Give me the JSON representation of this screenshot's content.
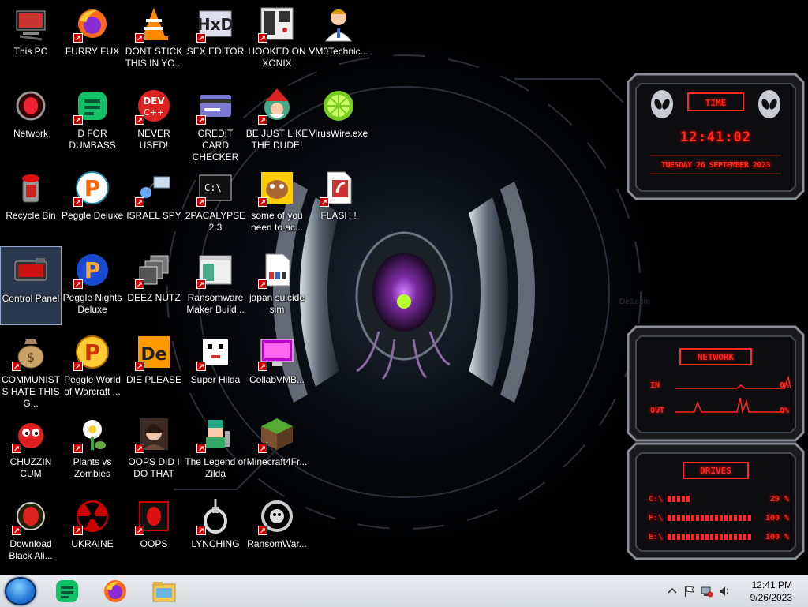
{
  "desktop_icons": [
    {
      "label": "This PC",
      "icon": "computer-icon",
      "shortcut": false
    },
    {
      "label": "Network",
      "icon": "alienware-network-icon",
      "shortcut": false
    },
    {
      "label": "Recycle Bin",
      "icon": "recycle-bin-icon",
      "shortcut": false
    },
    {
      "label": "Control Panel",
      "icon": "control-panel-icon",
      "shortcut": false
    },
    {
      "label": "COMMUNISTS HATE THIS G...",
      "icon": "money-bag-icon",
      "shortcut": true
    },
    {
      "label": "CHUZZIN CUM",
      "icon": "chuzzle-icon",
      "shortcut": true
    },
    {
      "label": "Download Black Ali...",
      "icon": "alienware-icon",
      "shortcut": true
    },
    {
      "label": "FURRY FUX",
      "icon": "firefox-icon",
      "shortcut": true
    },
    {
      "label": "D FOR DUMBASS",
      "icon": "green-doc-icon",
      "shortcut": true
    },
    {
      "label": "Peggle Deluxe",
      "icon": "peggle-icon",
      "shortcut": true
    },
    {
      "label": "Peggle Nights Deluxe",
      "icon": "peggle-nights-icon",
      "shortcut": true
    },
    {
      "label": "Peggle World of Warcraft ...",
      "icon": "peggle-wow-icon",
      "shortcut": true
    },
    {
      "label": "Plants vs Zombies",
      "icon": "flower-icon",
      "shortcut": true
    },
    {
      "label": "UKRAINE",
      "icon": "radiation-icon",
      "shortcut": true
    },
    {
      "label": "DONT STICK THIS IN YO...",
      "icon": "vlc-cone-icon",
      "shortcut": true
    },
    {
      "label": "NEVER USED!",
      "icon": "devcpp-icon",
      "shortcut": true
    },
    {
      "label": "ISRAEL SPY",
      "icon": "network-spy-icon",
      "shortcut": true
    },
    {
      "label": "DEEZ NUTZ",
      "icon": "stacked-windows-icon",
      "shortcut": true
    },
    {
      "label": "DIE PLEASE",
      "icon": "de-icon",
      "shortcut": true
    },
    {
      "label": "OOPS DID I DO THAT",
      "icon": "portrait-icon",
      "shortcut": true
    },
    {
      "label": "OOPS",
      "icon": "red-alien-icon",
      "shortcut": true
    },
    {
      "label": "SEX EDITOR",
      "icon": "hxd-icon",
      "shortcut": true
    },
    {
      "label": "CREDIT CARD CHECKER",
      "icon": "credit-card-icon",
      "shortcut": true
    },
    {
      "label": "2PACALYPSE 2.3",
      "icon": "terminal-icon",
      "shortcut": true
    },
    {
      "label": "Ransomware Maker Build...",
      "icon": "window-app-icon",
      "shortcut": true
    },
    {
      "label": "Super Hilda",
      "icon": "pixel-dog-icon",
      "shortcut": true
    },
    {
      "label": "The Legend of Zilda",
      "icon": "pixel-hero-icon",
      "shortcut": true
    },
    {
      "label": "LYNCHING",
      "icon": "noose-icon",
      "shortcut": true
    },
    {
      "label": "HOOKED ON XONIX",
      "icon": "xonix-icon",
      "shortcut": true
    },
    {
      "label": "BE JUST LIKE THE DUDE!",
      "icon": "santa-icon",
      "shortcut": true
    },
    {
      "label": "some of you need to ac...",
      "icon": "cartoon-dog-icon",
      "shortcut": true
    },
    {
      "label": "japan suicide sim",
      "icon": "document-icon",
      "shortcut": true
    },
    {
      "label": "CollabVMB...",
      "icon": "screen-icon",
      "shortcut": true
    },
    {
      "label": "Minecraft4Fr...",
      "icon": "grass-block-icon",
      "shortcut": true
    },
    {
      "label": "RansomWar...",
      "icon": "skull-ring-icon",
      "shortcut": true
    },
    {
      "label": "VM0Technic...",
      "icon": "doctor-icon",
      "shortcut": false
    },
    {
      "label": "VirusWire.exe",
      "icon": "lime-icon",
      "shortcut": false
    },
    {
      "label": "FLASH !",
      "icon": "flash-icon",
      "shortcut": true
    }
  ],
  "gadget_time": {
    "title": "TIME",
    "time": "12:41:02",
    "date": "TUESDAY 26 SEPTEMBER 2023"
  },
  "gadget_network": {
    "title": "NETWORK",
    "in_label": "IN",
    "in_value": "0%",
    "out_label": "OUT",
    "out_value": "0%"
  },
  "gadget_drives": {
    "title": "DRIVES",
    "drives": [
      {
        "label": "C:\\",
        "value": "29 %",
        "fill": 0.29
      },
      {
        "label": "F:\\",
        "value": "100 %",
        "fill": 1.0
      },
      {
        "label": "E:\\",
        "value": "100 %",
        "fill": 1.0
      }
    ]
  },
  "taskbar": {
    "apps": [
      {
        "name": "green-doc-app",
        "icon": "green-doc-icon"
      },
      {
        "name": "firefox-app",
        "icon": "firefox-icon"
      },
      {
        "name": "file-explorer-app",
        "icon": "folder-icon"
      }
    ],
    "clock_time": "12:41 PM",
    "clock_date": "9/26/2023"
  },
  "colors": {
    "gadget_red": "#ff2a1a",
    "taskbar_bg": "#e0e4e9",
    "selection": "#78a0dc"
  }
}
